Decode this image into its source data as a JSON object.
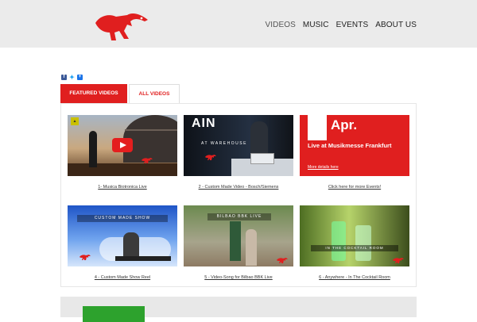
{
  "nav": {
    "items": [
      "VIDEOS",
      "MUSIC",
      "EVENTS",
      "ABOUT US"
    ]
  },
  "social": {
    "icons": [
      "facebook-icon",
      "twitter-icon",
      "plus-share-icon"
    ]
  },
  "tabs": {
    "featured": "FEATURED VIDEOS",
    "all": "ALL VIDEOS"
  },
  "videos": [
    {
      "caption": "1- Musica Biotronica Live"
    },
    {
      "caption": "2 - Custom Made Video - Bosch/Siemens",
      "title": "AIN",
      "subtitle": "AT WAREHOUSE"
    },
    {
      "caption": "Click here for more Events!"
    },
    {
      "caption": "4 -  Custom Made Show Reel",
      "overlay": "CUSTOM MADE SHOW"
    },
    {
      "caption": "5 - Video-Song for Bilbao BBK Live",
      "overlay": "BILBAO BBK LIVE"
    },
    {
      "caption": "6 - Anywhere - In The Cocktail Room",
      "overlay": "IN THE COCKTAIL ROOM"
    }
  ],
  "event": {
    "month": "Apr.",
    "text": "Live at Musikmesse Frankfurt",
    "more": "More details here"
  },
  "colors": {
    "accent": "#e01f1f",
    "header_bg": "#ebebeb"
  }
}
